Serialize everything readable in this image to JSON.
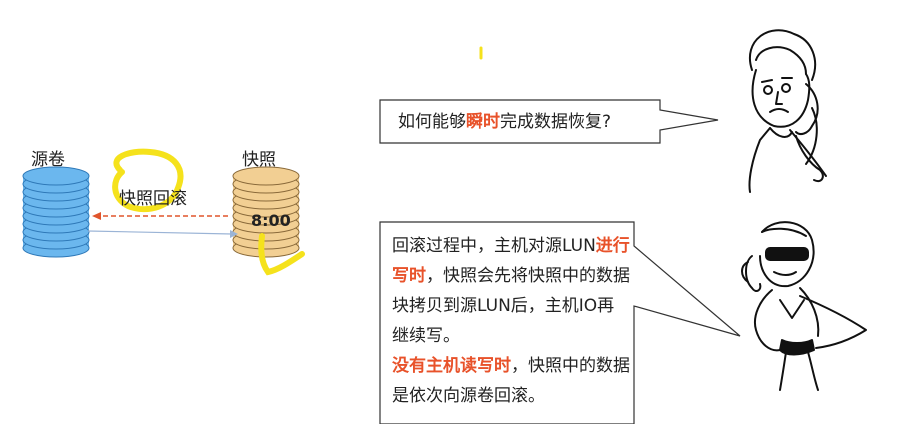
{
  "left_diagram": {
    "source_label": "源卷",
    "snapshot_label": "快照",
    "rollback_label": "快照回滚",
    "snapshot_time": "8:00"
  },
  "question_bubble": {
    "before": "如何能够",
    "highlight": "瞬时",
    "after": "完成数据恢复?"
  },
  "answer_bubble": {
    "seg1": "回滚过程中，主机对源LUN",
    "seg1_hl": "进行写时",
    "seg2": "，快照会先将快照中的数据块拷贝到源LUN后，主机IO再继续写。",
    "seg3_hl": "没有主机读写时",
    "seg3": "，快照中的数据是依次向源卷回滚。"
  },
  "colors": {
    "highlight": "#e8522a",
    "source_disk": "#6bb7ee",
    "snapshot_disk": "#f2cf93",
    "annotation": "#f5e21c"
  }
}
